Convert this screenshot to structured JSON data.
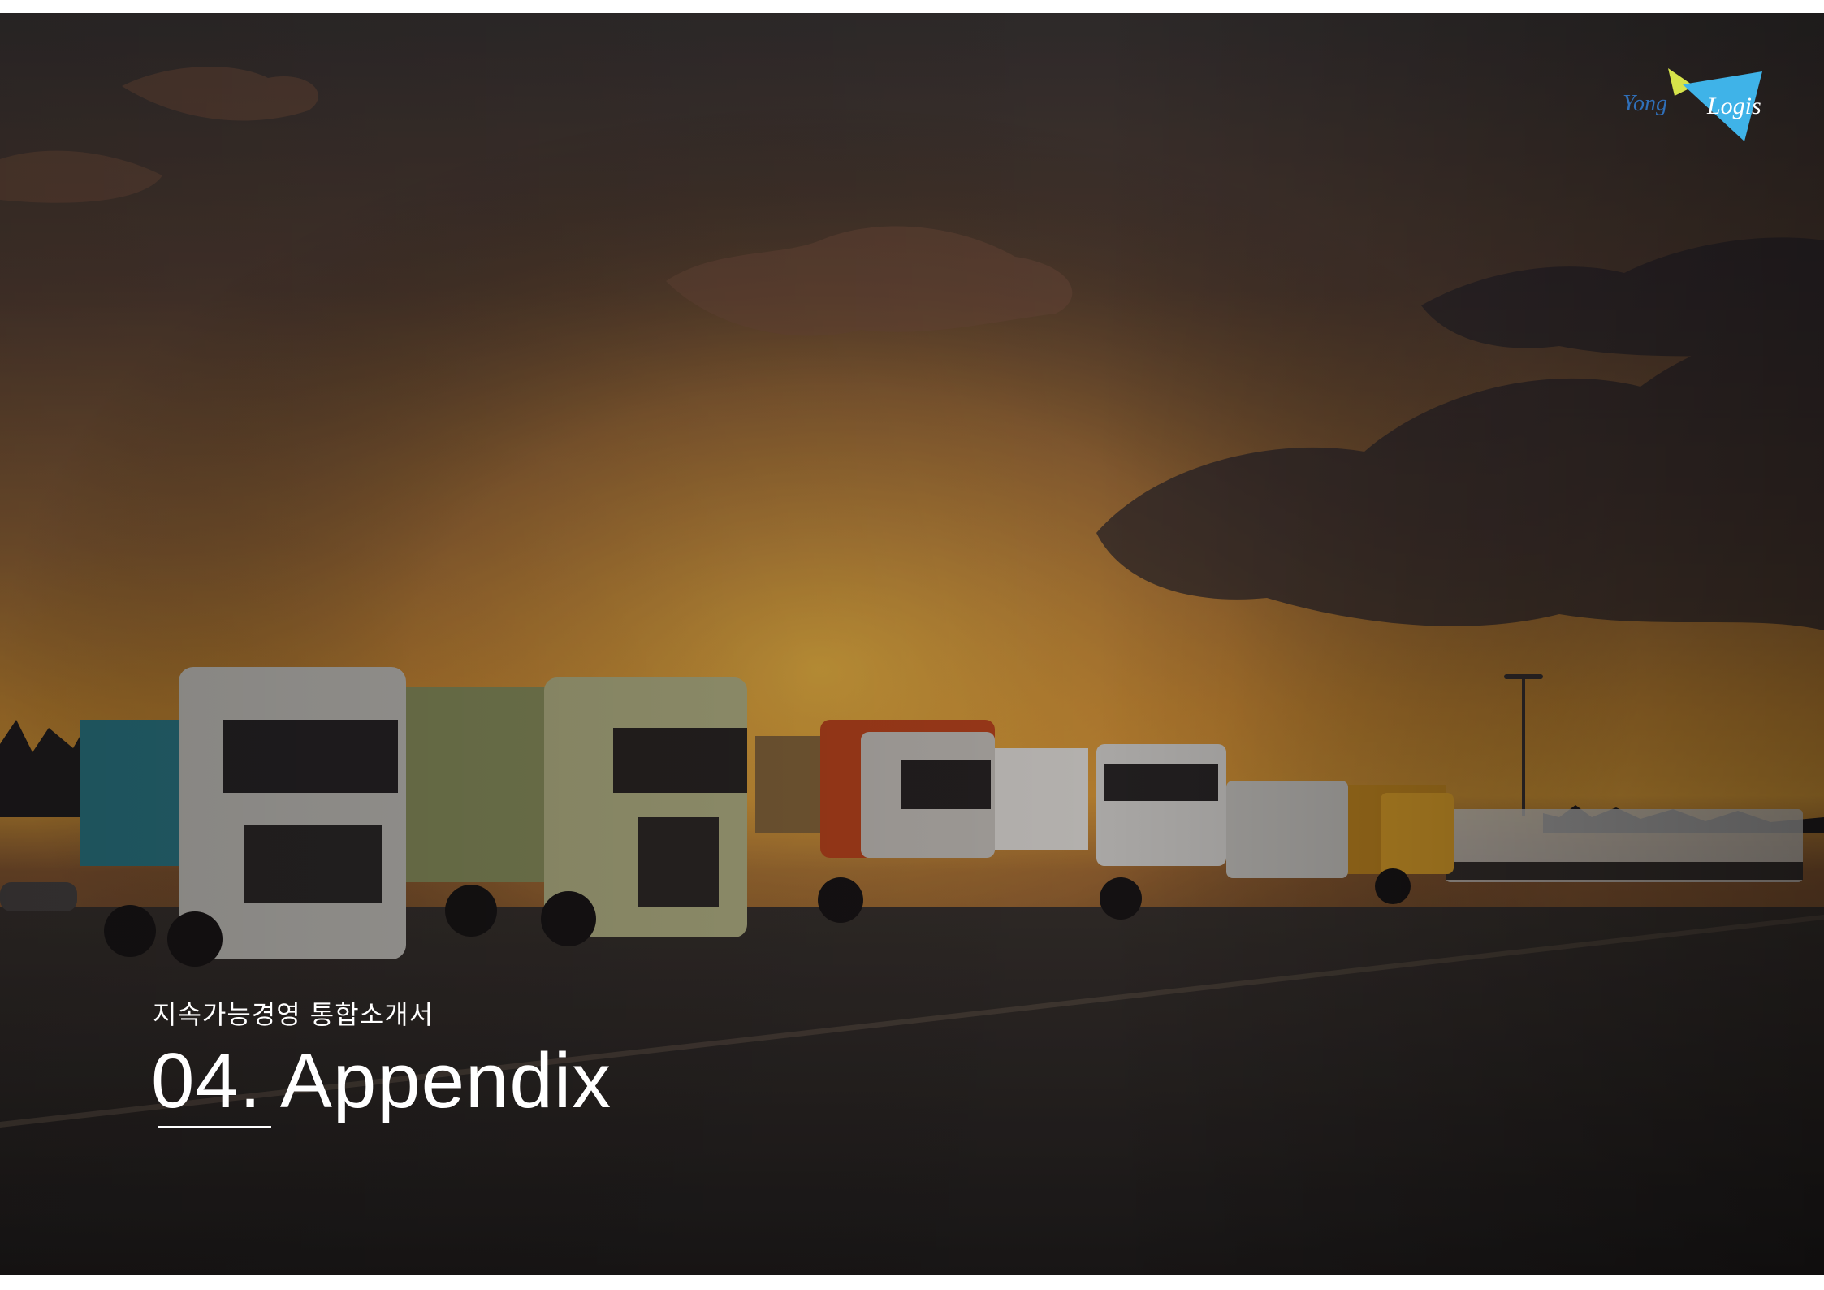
{
  "cover": {
    "subtitle": "지속가능경영 통합소개서",
    "title": "04. Appendix"
  },
  "logo": {
    "text_part1": "Yong",
    "text_part2": "Logis",
    "colors": {
      "yellow": "#d6e34a",
      "blue": "#3fb3e8",
      "text": "#2f6fb8"
    }
  },
  "background": {
    "description_icon": "truck-fleet-sunset-photo",
    "colors": {
      "sky_top": "#3b3535",
      "sky_glow": "#e9a13a",
      "ground": "#2a2626"
    }
  }
}
